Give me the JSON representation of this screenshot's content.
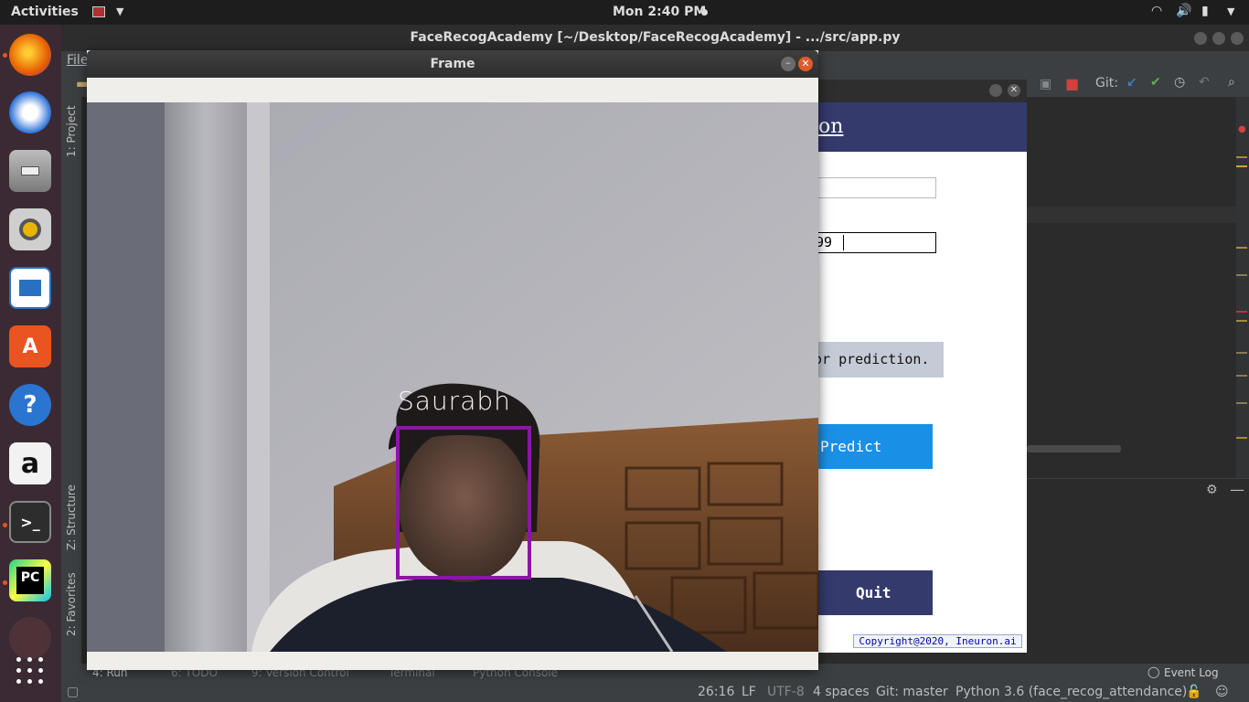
{
  "topbar": {
    "activities": "Activities",
    "clock": "Mon  2:40 PM"
  },
  "dock": {
    "items": [
      {
        "name": "firefox",
        "glyph": "",
        "color": "#e66000"
      },
      {
        "name": "thunderbird",
        "glyph": "",
        "color": "#2a6fd6"
      },
      {
        "name": "files",
        "glyph": "",
        "color": "#9a9a9a"
      },
      {
        "name": "rhythmbox",
        "glyph": "",
        "color": "#d0d0d0"
      },
      {
        "name": "writer",
        "glyph": "",
        "color": "#2a70c0"
      },
      {
        "name": "software",
        "glyph": "A",
        "color": "#e95420"
      },
      {
        "name": "help",
        "glyph": "?",
        "color": "#2a75d0"
      },
      {
        "name": "amazon",
        "glyph": "a",
        "color": "#f2f2f2"
      },
      {
        "name": "terminal",
        "glyph": ">_",
        "color": "#2d2d2d"
      },
      {
        "name": "pycharm",
        "glyph": "PC",
        "color": "#111111"
      }
    ]
  },
  "ide": {
    "title": "FaceRecogAcademy [~/Desktop/FaceRecogAcademy] - .../src/app.py",
    "menu_file": "File",
    "git_label": "Git:",
    "side_project": "1: Project",
    "side_structure": "Z: Structure",
    "side_favorites": "2: Favorites",
    "bottom_tabs": [
      "4: Run",
      "6: TODO",
      "9: Version Control",
      "Terminal",
      "Python Console"
    ],
    "event_log": "Event Log",
    "status": {
      "position": "26:16",
      "line_sep": "LF",
      "encoding": "UTF-8",
      "indent": "4 spaces",
      "vcs": "Git: master",
      "interpreter": "Python 3.6 (face_recog_attendance)"
    }
  },
  "tk_app": {
    "banner_text": "on",
    "entry_top_value": "",
    "entry_bottom_value": "999",
    "info_text": "or prediction.",
    "predict_label": "Predict",
    "quit_label": "Quit",
    "copyright": "Copyright@2020, Ineuron.ai"
  },
  "frame_window": {
    "title": "Frame",
    "detected_name": "Saurabh",
    "box_color": "#8e14a8"
  }
}
